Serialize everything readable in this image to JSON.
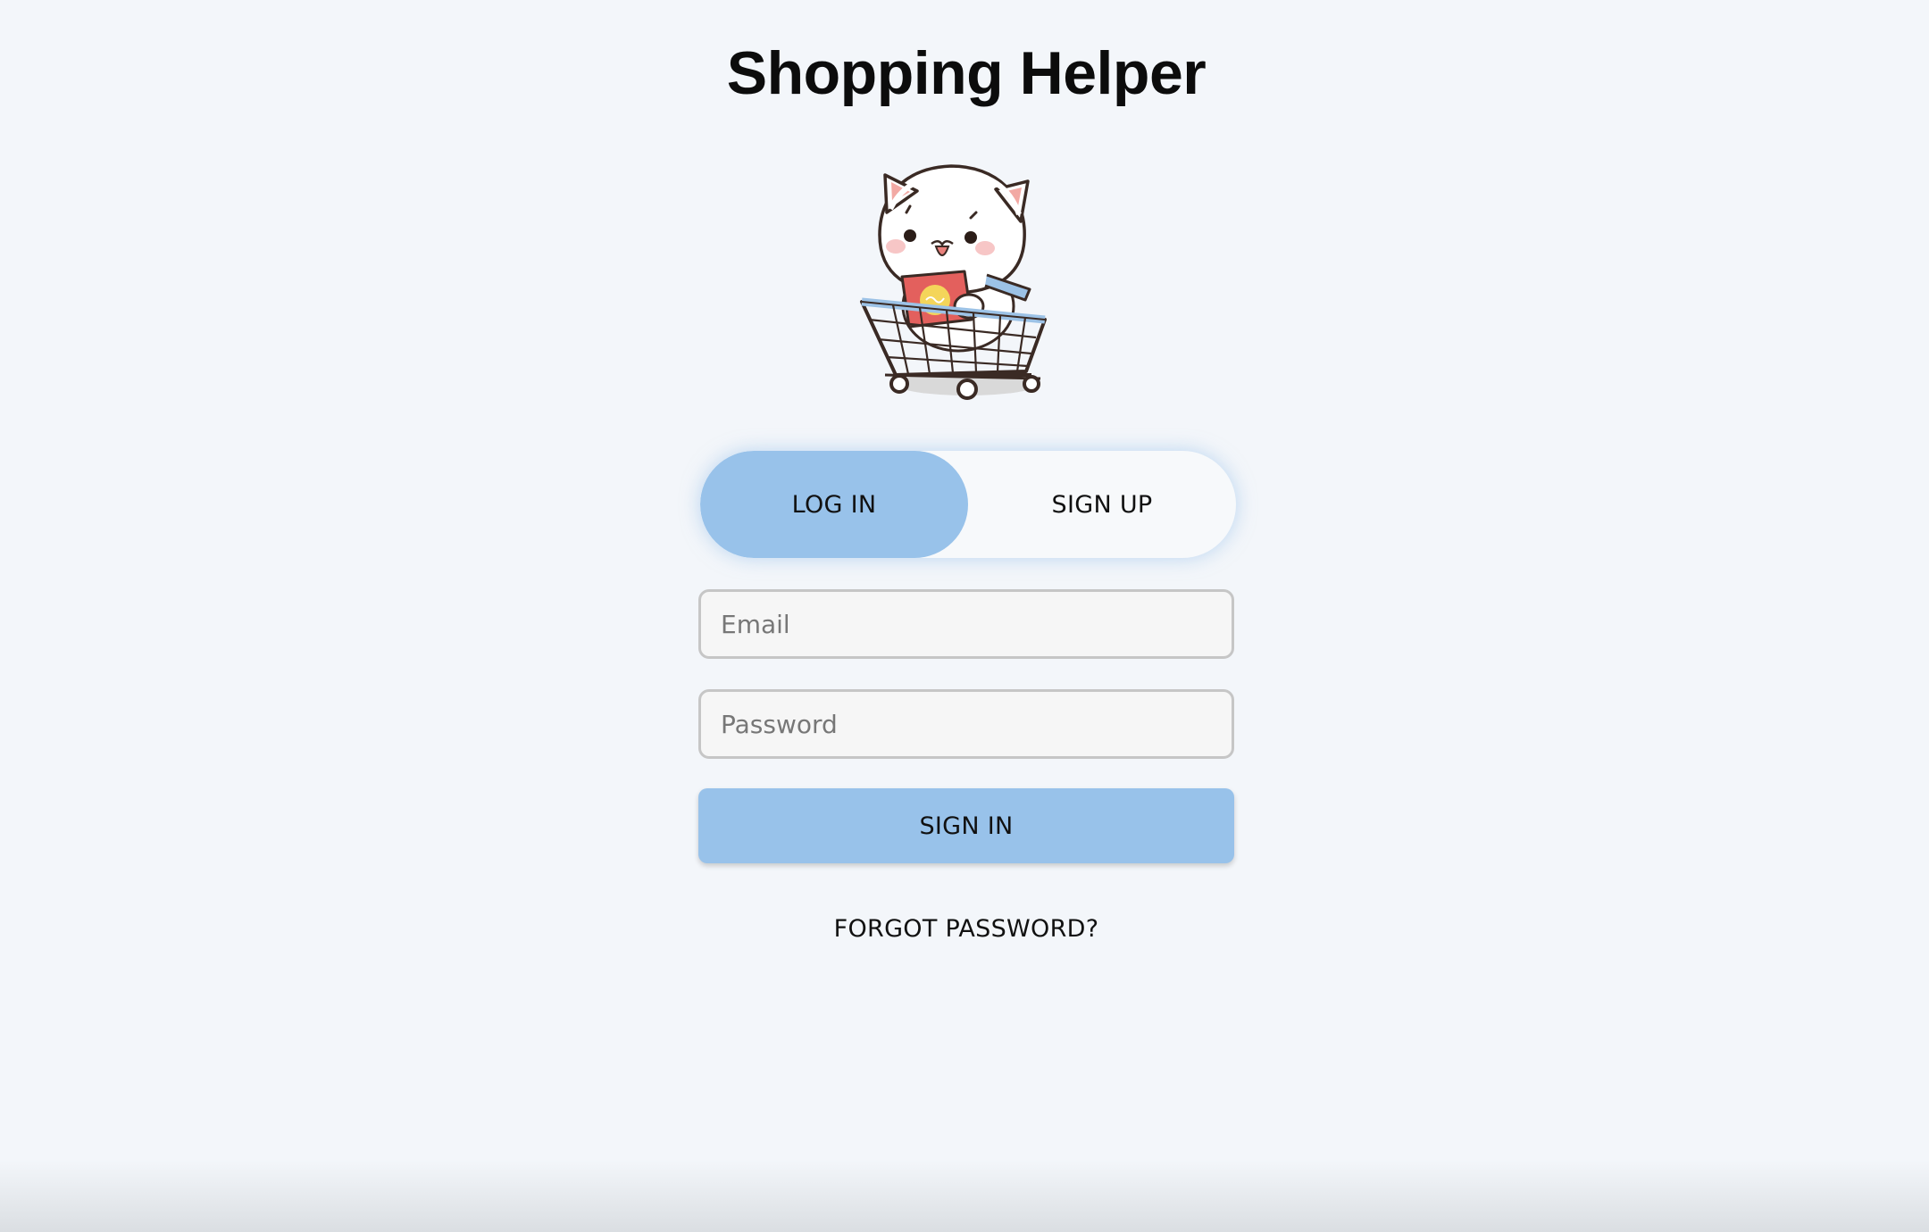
{
  "app": {
    "title": "Shopping Helper"
  },
  "mascot": {
    "icon": "cat-in-shopping-cart-icon"
  },
  "auth_tabs": {
    "login_label": "LOG IN",
    "signup_label": "SIGN UP",
    "active": "login"
  },
  "form": {
    "email_placeholder": "Email",
    "email_value": "",
    "password_placeholder": "Password",
    "password_value": "",
    "submit_label": "SIGN IN",
    "forgot_label": "FORGOT PASSWORD?"
  },
  "colors": {
    "background": "#f3f6fa",
    "accent": "#98c2ea"
  }
}
